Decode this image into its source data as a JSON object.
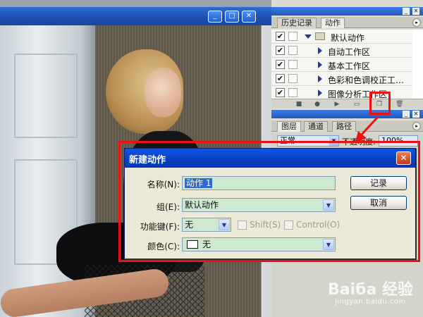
{
  "document": {
    "window_controls": [
      "_",
      "□",
      "✕"
    ]
  },
  "actions_panel": {
    "panel_controls": [
      "_",
      "✕"
    ],
    "tabs": [
      "历史记录",
      "动作"
    ],
    "menu_arrow": "▸",
    "rows": [
      {
        "check": "✔",
        "label": "默认动作",
        "kind": "set"
      },
      {
        "check": "✔",
        "label": "自动工作区",
        "kind": "action"
      },
      {
        "check": "✔",
        "label": "基本工作区",
        "kind": "action"
      },
      {
        "check": "✔",
        "label": "色彩和色调校正工…",
        "kind": "action"
      },
      {
        "check": "✔",
        "label": "图像分析工作区",
        "kind": "action"
      }
    ],
    "toolbar_icons": [
      "stop-icon",
      "record-icon",
      "play-icon",
      "new-set-icon",
      "new-action-icon",
      "trash-icon"
    ]
  },
  "layers_panel": {
    "panel_controls": [
      "_",
      "✕"
    ],
    "tabs": [
      "图层",
      "通道",
      "路径"
    ],
    "menu_arrow": "▸",
    "blend_mode": "正常",
    "opacity_label": "不透明度:",
    "opacity_value": "100%"
  },
  "dialog": {
    "title": "新建动作",
    "close": "✕",
    "name_label": "名称(N):",
    "name_value": "动作 1",
    "set_label": "组(E):",
    "set_value": "默认动作",
    "fkey_label": "功能键(F):",
    "fkey_value": "无",
    "shift_label": "Shift(S)",
    "control_label": "Control(O)",
    "color_label": "颜色(C):",
    "color_value": "无",
    "record_button": "记录",
    "cancel_button": "取消",
    "dropdown_glyph": "▼"
  },
  "watermark": {
    "main": "Baiбa 经验",
    "sub": "jingyan.baidu.com"
  },
  "colors": {
    "highlight": "#e11111",
    "xp_title": "#0840c4",
    "field_bg": "#cfe8d0"
  }
}
